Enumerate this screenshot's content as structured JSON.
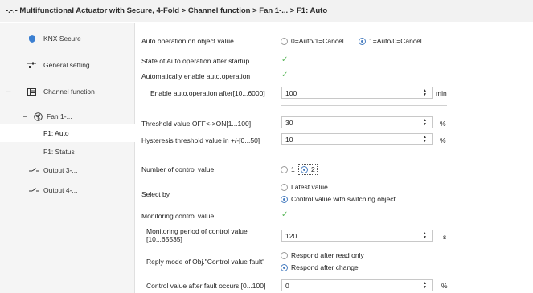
{
  "window": {
    "title": "-.-.- Multifunctional Actuator with Secure, 4-Fold > Channel function > Fan 1-... > F1: Auto"
  },
  "sidebar": {
    "items": [
      {
        "label": "KNX Secure"
      },
      {
        "label": "General setting"
      },
      {
        "label": "Channel function"
      },
      {
        "label": "Fan 1-..."
      },
      {
        "label": "F1: Auto"
      },
      {
        "label": "F1: Status"
      },
      {
        "label": "Output 3-..."
      },
      {
        "label": "Output 4-..."
      }
    ]
  },
  "params": {
    "auto_op_on_object": {
      "label": "Auto.operation on object value",
      "options": [
        "0=Auto/1=Cancel",
        "1=Auto/0=Cancel"
      ],
      "selected": "1=Auto/0=Cancel"
    },
    "state_after_startup": {
      "label": "State of Auto.operation after startup",
      "checked": true
    },
    "auto_enable": {
      "label": "Automatically enable auto.operation",
      "checked": true
    },
    "enable_after": {
      "label": "Enable auto.operation after[10...6000]",
      "value": "100",
      "unit": "min"
    },
    "threshold_off_on": {
      "label": "Threshold value OFF<->ON[1...100]",
      "value": "30",
      "unit": "%"
    },
    "hysteresis": {
      "label": "Hysteresis threshold value in +/-[0...50]",
      "value": "10",
      "unit": "%"
    },
    "num_control_value": {
      "label": "Number of control value",
      "options": [
        "1",
        "2"
      ],
      "selected": "2"
    },
    "select_by": {
      "label": "Select by",
      "options": [
        "Latest value",
        "Control value with switching object"
      ],
      "selected": "Control value with switching object"
    },
    "monitoring": {
      "label": "Monitoring control value",
      "checked": true
    },
    "monitoring_period": {
      "label": "Monitoring period of control value [10...65535]",
      "value": "120",
      "unit": "s"
    },
    "reply_mode": {
      "label": "Reply mode of Obj.\"Control value fault\"",
      "options": [
        "Respond after read only",
        "Respond after change"
      ],
      "selected": "Respond after change"
    },
    "after_fault": {
      "label": "Control value after fault occurs [0...100]",
      "value": "0",
      "unit": "%"
    }
  },
  "icons": {
    "knx_secure": "shield-icon",
    "general": "sliders-icon",
    "channel": "grid-icon",
    "fan": "fan-icon",
    "output": "switch-icon",
    "check": "check-icon",
    "spin": "spin-arrows-icon"
  },
  "colors": {
    "accent": "#4a7fc1",
    "check": "#5cb85c",
    "sidebar_bg": "#f5f5f5",
    "titlebar_bg": "#f2f2f2"
  }
}
